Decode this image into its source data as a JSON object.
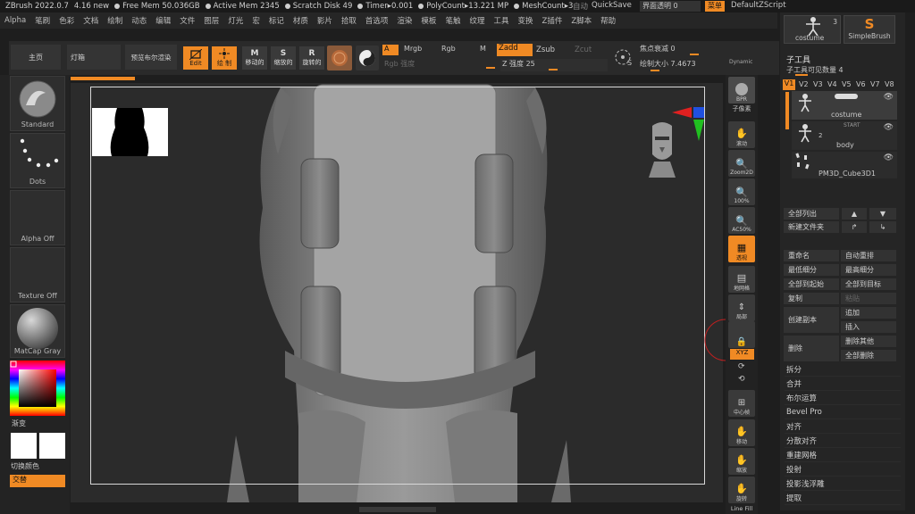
{
  "titlebar": {
    "app": "ZBrush 2022.0.7",
    "size": "4.16 new",
    "free_mem": "Free Mem 50.036GB",
    "active_mem": "Active Mem 2345",
    "scratch": "Scratch Disk 49",
    "timer": "Timer▸0.001",
    "polycount": "PolyCount▸13.221 MP",
    "meshcount": "MeshCount▸3",
    "auto": "自动",
    "quicksave": "QuickSave",
    "transparency": "界面透明 0",
    "menu_btn": "菜单",
    "script": "DefaultZScript"
  },
  "menubar": [
    "Alpha",
    "笔刷",
    "色彩",
    "文档",
    "绘制",
    "动态",
    "编辑",
    "文件",
    "图层",
    "灯光",
    "宏",
    "标记",
    "材质",
    "影片",
    "拾取",
    "首选项",
    "渲染",
    "模板",
    "笔触",
    "纹理",
    "工具",
    "变换",
    "Z插件",
    "Z脚本",
    "帮助"
  ],
  "toolbar": {
    "home": "主页",
    "lightbox": "灯箱",
    "preview": "预览布尔渲染",
    "edit": "Edit",
    "draw": "绘 制",
    "move": "移动的",
    "scale": "缩放的",
    "rotate": "旋转的",
    "a": "A",
    "mrgb": "Mrgb",
    "rgb": "Rgb",
    "m": "M",
    "zadd": "Zadd",
    "zsub": "Zsub",
    "zcut": "Zcut",
    "rgb_strength": "Rgb 强度",
    "z_strength": "Z 强度 25",
    "focal_shift": "焦点衰减 0",
    "draw_size": "绘制大小 7.4673",
    "dynamic": "Dynamic",
    "s": "S"
  },
  "left": {
    "standard": "Standard",
    "dots": "Dots",
    "alpha_off": "Alpha Off",
    "texture_off": "Texture Off",
    "matcap": "MatCap Gray",
    "gradient": "渐变",
    "switch_color": "切换颜色",
    "alternate": "交替"
  },
  "shelf": {
    "bpr": "BPR",
    "subpixel": "子像素",
    "scroll": "滚动",
    "zoom2d": "Zoom2D",
    "pct100": "100%",
    "ac50": "AC50%",
    "perspective": "透视",
    "floor": "地网格",
    "local": "局部",
    "lock": "",
    "xyz": "XYZ",
    "frame": "中心帧",
    "move": "移动",
    "zoom": "缩放",
    "rotate": "旋转",
    "linefill": "Line Fill"
  },
  "rpanel": {
    "costume": "costume",
    "costume_count": "3",
    "simplebrush": "SimpleBrush",
    "subtool_title": "子工具",
    "visible_count": "子工具可见数量 4",
    "versions": [
      "V1",
      "V2",
      "V3",
      "V4",
      "V5",
      "V6",
      "V7",
      "V8"
    ],
    "items": [
      {
        "name": "costume",
        "level": ""
      },
      {
        "name": "body",
        "level": "2"
      },
      {
        "name": "PM3D_Cube3D1",
        "level": ""
      }
    ],
    "start": "START",
    "all_list": "全部列出",
    "new_folder": "新建文件夹",
    "rename": "重命名",
    "auto_reorder": "自动重排",
    "lowest_sub": "最低细分",
    "highest_sub": "最高细分",
    "all_to_start": "全部到起始",
    "all_to_target": "全部到目标",
    "copy": "复制",
    "paste": "粘贴",
    "create_copy": "创建副本",
    "append": "追加",
    "insert": "插入",
    "delete": "删除",
    "delete_others": "删除其他",
    "delete_all": "全部删除",
    "list": [
      "拆分",
      "合并",
      "布尔运算",
      "Bevel Pro",
      "对齐",
      "分散对齐",
      "重建网格",
      "投射",
      "投影浅浮雕",
      "提取"
    ]
  },
  "colors": {
    "accent": "#f08a24",
    "panel": "#2a2a2a",
    "canvas": "#2b2b2b"
  }
}
